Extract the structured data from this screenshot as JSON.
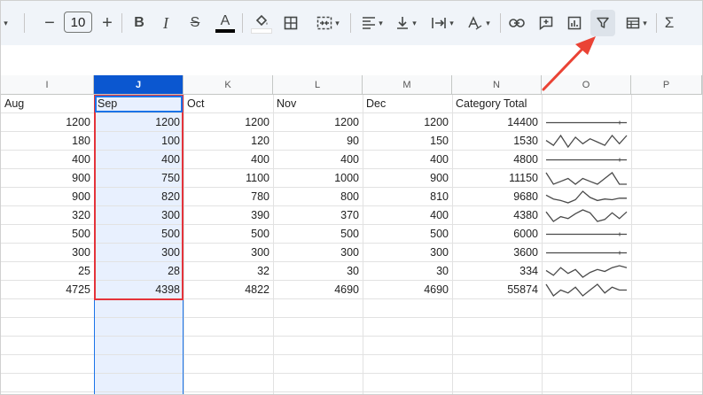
{
  "toolbar": {
    "font_size": "10",
    "minus": "−",
    "plus": "+",
    "bold": "B",
    "italic": "I",
    "strike": "S",
    "text_color": "A",
    "sigma": "Σ",
    "icons": [
      "minus-icon",
      "plus-icon",
      "bold-icon",
      "italic-icon",
      "strikethrough-icon",
      "text-color-icon",
      "fill-color-icon",
      "borders-icon",
      "merge-cells-icon",
      "horizontal-align-icon",
      "vertical-align-icon",
      "text-wrapping-icon",
      "text-rotation-icon",
      "link-icon",
      "comment-icon",
      "chart-icon",
      "filter-icon",
      "filter-views-icon",
      "functions-icon"
    ]
  },
  "columns": [
    "I",
    "J",
    "K",
    "L",
    "M",
    "N",
    "O",
    "P"
  ],
  "selected_column": "J",
  "header_row": [
    "Aug",
    "Sep",
    "Oct",
    "Nov",
    "Dec",
    "Category Total"
  ],
  "rows": [
    [
      "1200",
      "1200",
      "1200",
      "1200",
      "1200",
      "14400"
    ],
    [
      "180",
      "100",
      "120",
      "90",
      "150",
      "1530"
    ],
    [
      "400",
      "400",
      "400",
      "400",
      "400",
      "4800"
    ],
    [
      "900",
      "750",
      "1100",
      "1000",
      "900",
      "11150"
    ],
    [
      "900",
      "820",
      "780",
      "800",
      "810",
      "9680"
    ],
    [
      "320",
      "300",
      "390",
      "370",
      "400",
      "4380"
    ],
    [
      "500",
      "500",
      "500",
      "500",
      "500",
      "6000"
    ],
    [
      "300",
      "300",
      "300",
      "300",
      "300",
      "3600"
    ],
    [
      "25",
      "28",
      "32",
      "30",
      "30",
      "334"
    ],
    [
      "4725",
      "4398",
      "4822",
      "4690",
      "4690",
      "55874"
    ]
  ],
  "sparklines": [
    [
      1200,
      1200,
      1200,
      1200,
      1200,
      1200,
      1200,
      1200,
      1200,
      1200,
      1200,
      1200
    ],
    [
      120,
      90,
      150,
      80,
      140,
      100,
      130,
      110,
      90,
      150,
      100,
      150
    ],
    [
      400,
      400,
      400,
      400,
      400,
      400,
      400,
      400,
      400,
      400,
      400,
      400
    ],
    [
      1100,
      900,
      950,
      1000,
      900,
      1000,
      950,
      900,
      1000,
      1100,
      900,
      900
    ],
    [
      850,
      800,
      780,
      750,
      790,
      900,
      820,
      780,
      800,
      790,
      810,
      810
    ],
    [
      400,
      300,
      350,
      330,
      380,
      420,
      390,
      300,
      320,
      390,
      330,
      400
    ],
    [
      500,
      500,
      500,
      500,
      500,
      500,
      500,
      500,
      500,
      500,
      500,
      500
    ],
    [
      300,
      300,
      300,
      300,
      300,
      300,
      300,
      300,
      300,
      300,
      300,
      300
    ],
    [
      27,
      22,
      30,
      24,
      28,
      20,
      25,
      28,
      26,
      30,
      32,
      30
    ],
    [
      4900,
      4500,
      4700,
      4600,
      4800,
      4500,
      4700,
      4900,
      4600,
      4800,
      4700,
      4700
    ]
  ],
  "colors": {
    "selection_outline": "#e4343b",
    "selected_column_fill": "#e8f0fe",
    "selected_header": "#0b57d0",
    "annotation_arrow": "#ea4335"
  }
}
